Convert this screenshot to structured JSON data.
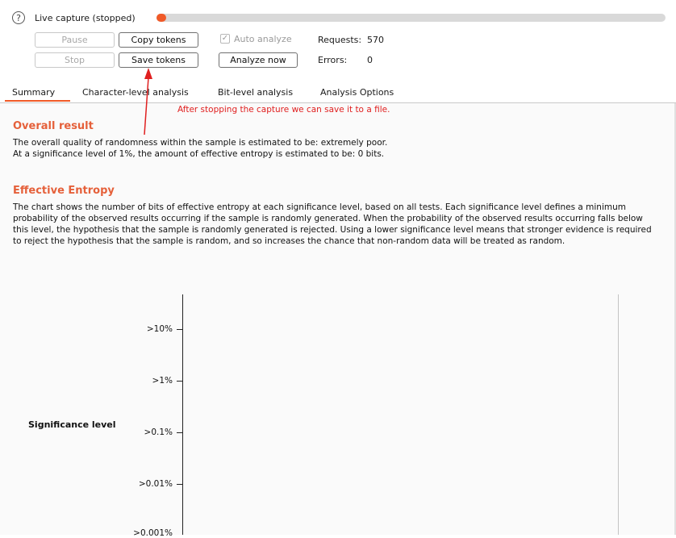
{
  "capture": {
    "help_icon": "question-mark",
    "status_label": "Live capture (stopped)",
    "progress_fraction": 0.01,
    "accent_color": "#f05a28"
  },
  "buttons": {
    "pause": "Pause",
    "stop": "Stop",
    "copy_tokens": "Copy tokens",
    "save_tokens": "Save tokens",
    "analyze_now": "Analyze now"
  },
  "auto_analyze": {
    "label": "Auto analyze",
    "checked": true
  },
  "stats": {
    "requests_label": "Requests:",
    "requests_value": "570",
    "errors_label": "Errors:",
    "errors_value": "0"
  },
  "tabs": [
    {
      "label": "Summary",
      "active": true
    },
    {
      "label": "Character-level analysis",
      "active": false
    },
    {
      "label": "Bit-level analysis",
      "active": false
    },
    {
      "label": "Analysis Options",
      "active": false
    }
  ],
  "annotation": {
    "text": "After stopping the capture we can save it to a file.",
    "color": "#e02020"
  },
  "overall": {
    "heading": "Overall result",
    "line1": "The overall quality of randomness within the sample is estimated to be: extremely poor.",
    "line2": "At a significance level of 1%, the amount of effective entropy is estimated to be: 0 bits."
  },
  "entropy": {
    "heading": "Effective Entropy",
    "description": "The chart shows the number of bits of effective entropy at each significance level, based on all tests. Each significance level defines a minimum probability of the observed results occurring if the sample is randomly generated. When the probability of the observed results occurring falls below this level, the hypothesis that the sample is randomly generated is rejected. Using a lower significance level means that stronger evidence is required to reject the hypothesis that the sample is random, and so increases the chance that non-random data will be treated as random."
  },
  "chart": {
    "ylabel": "Significance level",
    "ticks": [
      ">10%",
      ">1%",
      ">0.1%",
      ">0.01%",
      ">0.001%"
    ]
  }
}
